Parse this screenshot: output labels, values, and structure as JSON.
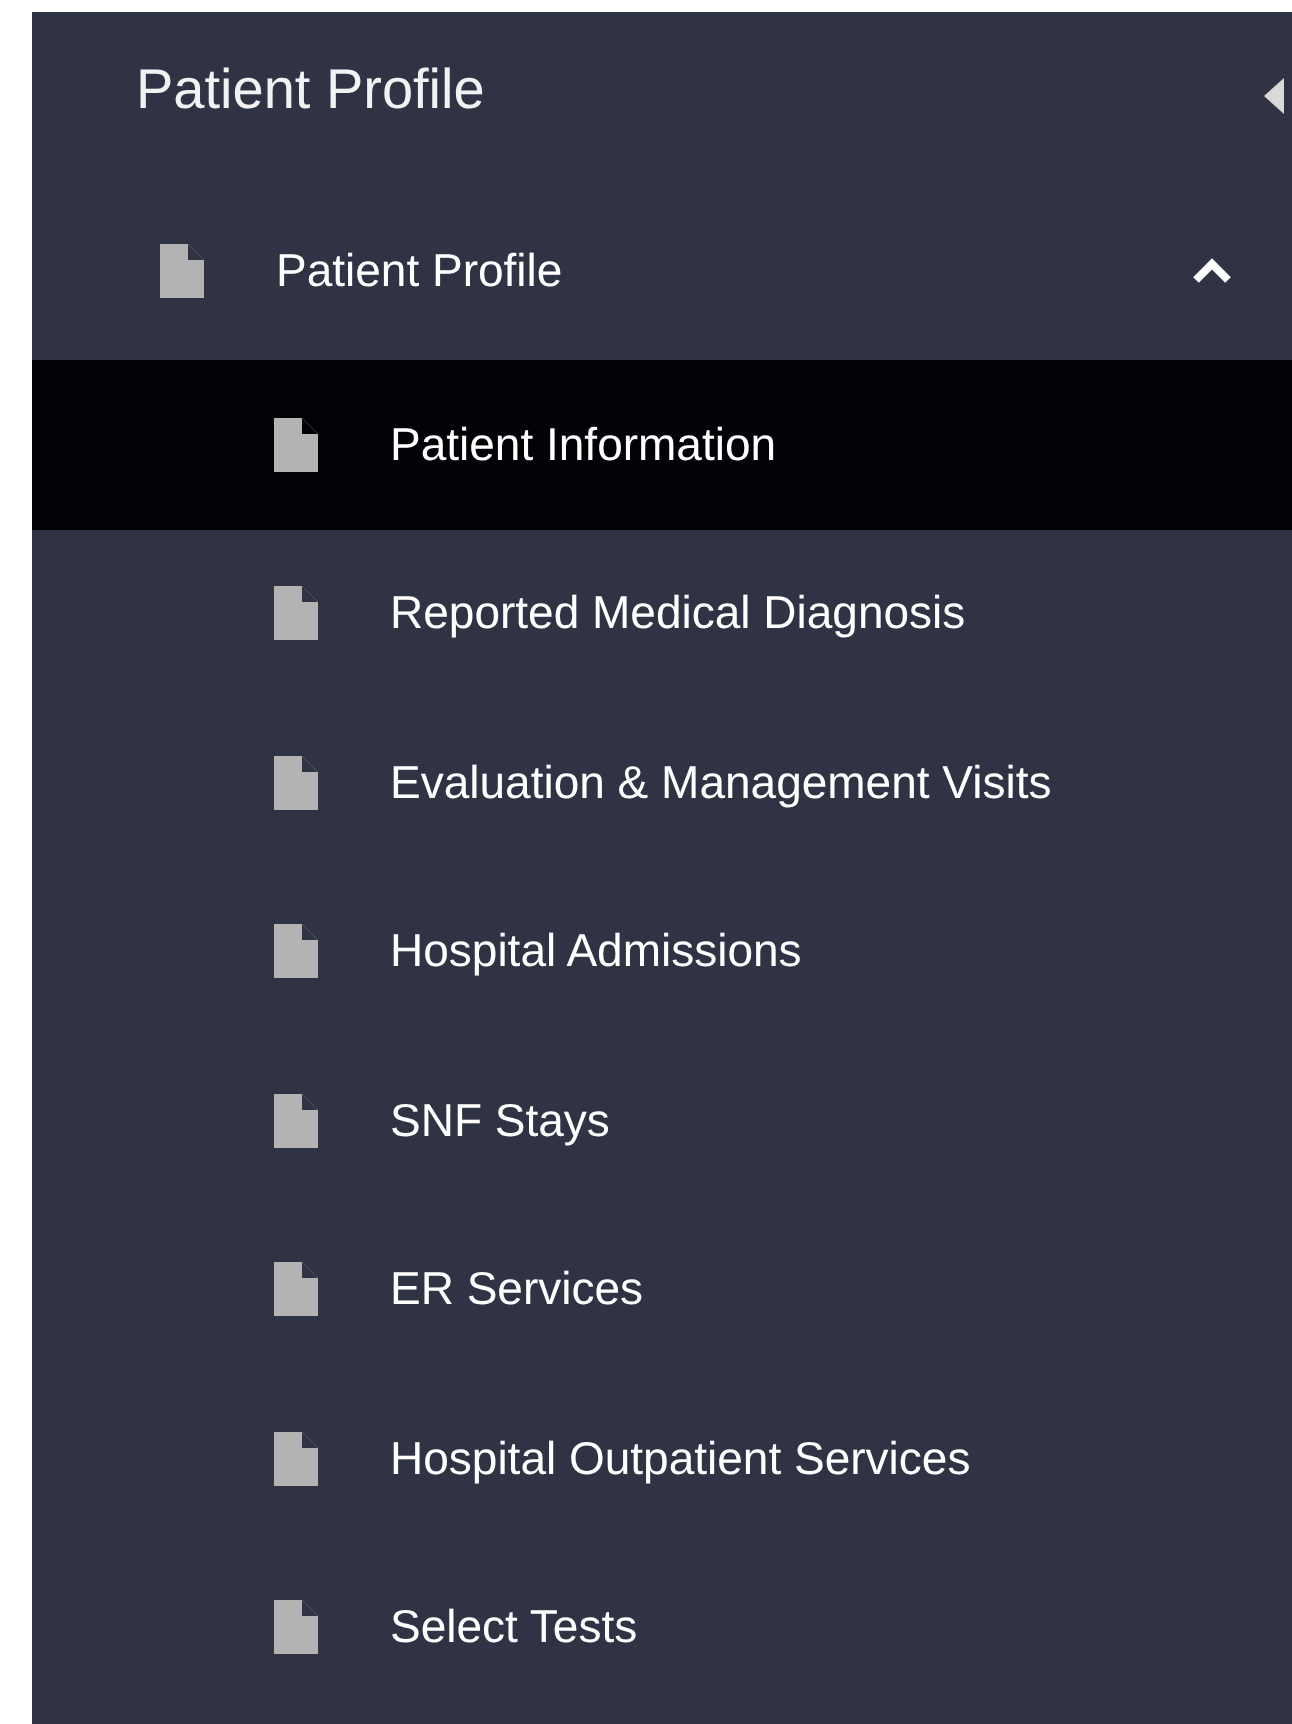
{
  "sidebar": {
    "title": "Patient Profile",
    "groups": [
      {
        "label": "Patient Profile",
        "expanded": true,
        "children": [
          {
            "label": "Patient Information",
            "selected": true
          },
          {
            "label": "Reported Medical Diagnosis",
            "selected": false
          },
          {
            "label": "Evaluation & Management Visits",
            "selected": false
          },
          {
            "label": "Hospital Admissions",
            "selected": false
          },
          {
            "label": "SNF Stays",
            "selected": false
          },
          {
            "label": "ER Services",
            "selected": false
          },
          {
            "label": "Hospital Outpatient Services",
            "selected": false
          },
          {
            "label": "Select Tests",
            "selected": false
          }
        ]
      }
    ]
  }
}
